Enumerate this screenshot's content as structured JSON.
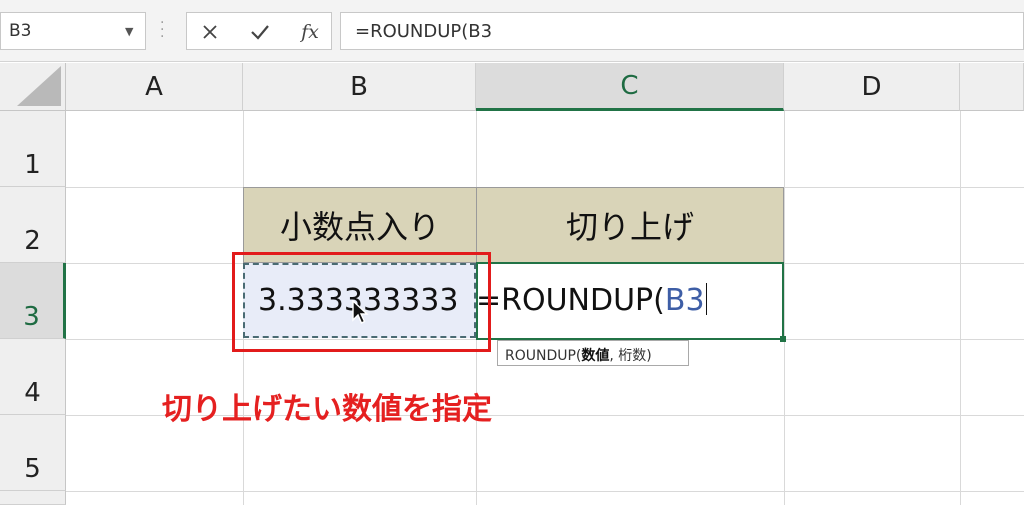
{
  "formula_bar": {
    "name_box": "B3",
    "cancel_icon": "✕",
    "enter_icon": "✔",
    "fx_label": "fx",
    "formula": "=ROUNDUP(B3"
  },
  "columns": [
    "A",
    "B",
    "C",
    "D"
  ],
  "active_column": "C",
  "rows": [
    "1",
    "2",
    "3",
    "4",
    "5"
  ],
  "active_row": "3",
  "cells": {
    "B2": "小数点入り",
    "C2": "切り上げ",
    "B3": "3.333333333",
    "C3_prefix": "=ROUNDUP(",
    "C3_ref": "B3"
  },
  "tooltip": {
    "fn": "ROUNDUP(",
    "arg1": "数値",
    "rest": ", 桁数)"
  },
  "annotation": "切り上げたい数値を指定",
  "colors": {
    "header_fill": "#d9d4b8",
    "selection_fill": "#e8ecf8",
    "excel_green": "#217346",
    "highlight_red": "#e21b1b",
    "ref_blue": "#3e5ea6"
  }
}
